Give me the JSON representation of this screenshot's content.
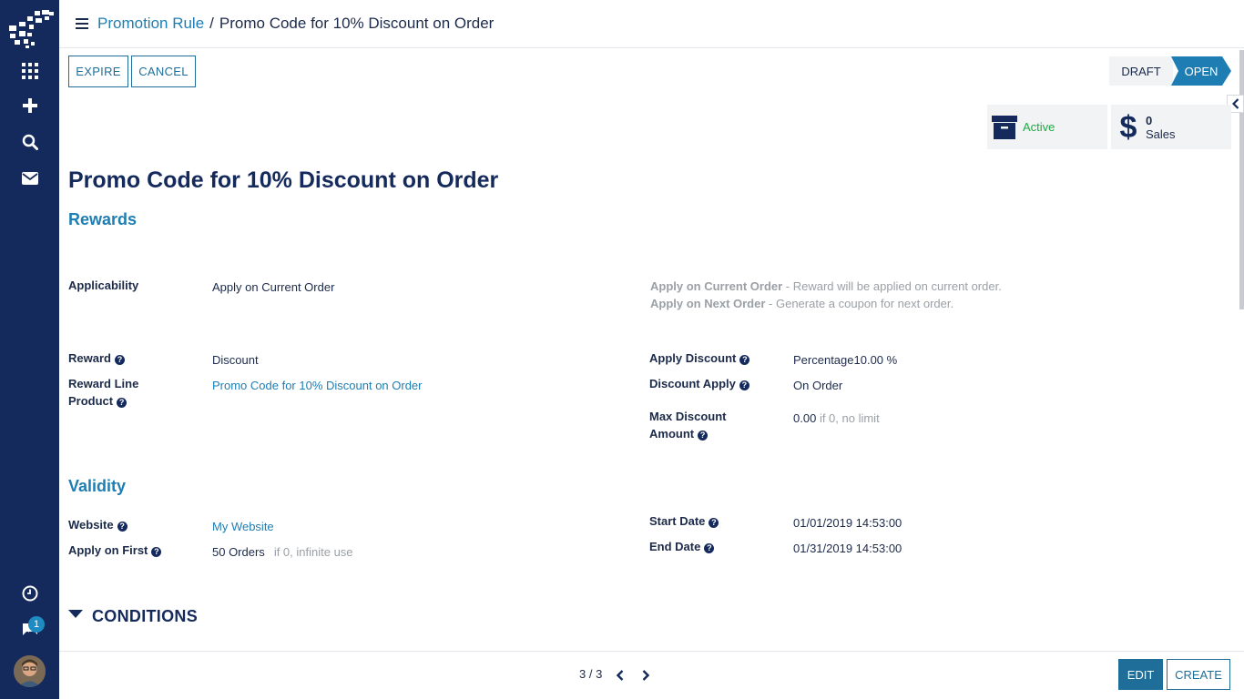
{
  "breadcrumb": {
    "parent": "Promotion Rule",
    "separator": "/",
    "current": "Promo Code for 10% Discount on Order"
  },
  "actions": {
    "expire": "EXPIRE",
    "cancel": "CANCEL"
  },
  "status": {
    "draft": "DRAFT",
    "open": "OPEN",
    "current": "OPEN"
  },
  "stat_buttons": {
    "active": "Active",
    "sales_count": "0",
    "sales_label": "Sales"
  },
  "title": "Promo Code for 10% Discount on Order",
  "rewards": {
    "heading": "Rewards",
    "applicability_label": "Applicability",
    "applicability_value": "Apply on Current Order",
    "hint_current_title": "Apply on Current Order",
    "hint_current_text": " - Reward will be applied on current order.",
    "hint_next_title": "Apply on Next Order",
    "hint_next_text": " - Generate a coupon for next order.",
    "reward_label": "Reward",
    "reward_value": "Discount",
    "reward_line_label_1": "Reward Line",
    "reward_line_label_2": "Product",
    "reward_line_value": "Promo Code for 10% Discount on Order",
    "apply_discount_label": "Apply Discount",
    "apply_discount_value": "Percentage10.00 %",
    "discount_apply_label": "Discount Apply",
    "discount_apply_value": "On Order",
    "max_discount_label_1": "Max Discount",
    "max_discount_label_2": "Amount",
    "max_discount_value": "0.00",
    "max_discount_hint": "if 0, no limit"
  },
  "validity": {
    "heading": "Validity",
    "website_label": "Website",
    "website_value": "My Website",
    "apply_first_label": "Apply on First",
    "apply_first_value": "50 Orders",
    "apply_first_hint": "if 0, infinite use",
    "start_date_label": "Start Date",
    "start_date_value": "01/01/2019 14:53:00",
    "end_date_label": "End Date",
    "end_date_value": "01/31/2019 14:53:00"
  },
  "conditions_heading": "CONDITIONS",
  "pager": "3 / 3",
  "footer": {
    "edit": "EDIT",
    "create": "CREATE"
  },
  "sidebar": {
    "notification_count": "1"
  },
  "help_glyph": "?",
  "colors": {
    "sidebar": "#152a5c",
    "accent": "#1e7eb3",
    "active_green": "#22a845"
  }
}
